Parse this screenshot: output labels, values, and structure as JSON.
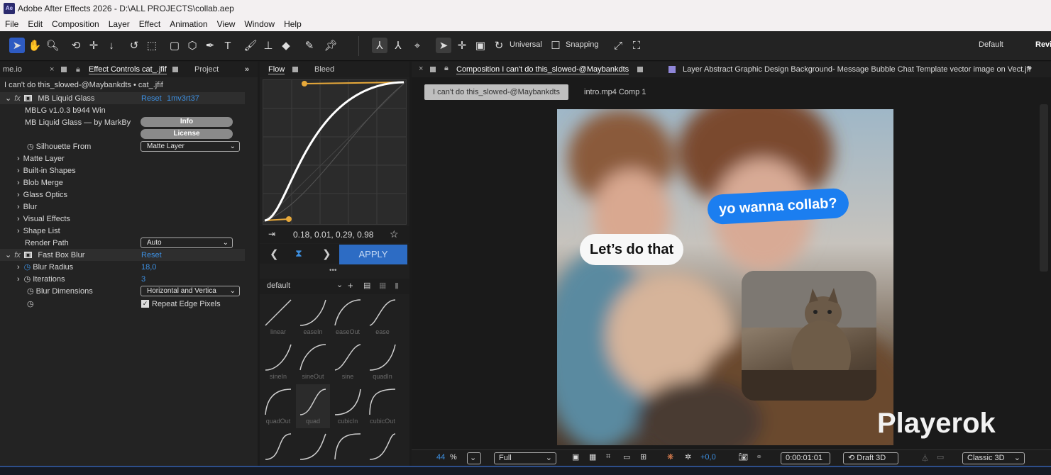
{
  "window": {
    "title": "Adobe After Effects 2026 - D:\\ALL PROJECTS\\collab.aep",
    "logo_text": "Ae"
  },
  "menu": [
    "File",
    "Edit",
    "Composition",
    "Layer",
    "Effect",
    "Animation",
    "View",
    "Window",
    "Help"
  ],
  "toolbar": {
    "universal_label": "Universal",
    "snapping_label": "Snapping",
    "workspace_default": "Default",
    "workspace_review": "Revi"
  },
  "left_panel": {
    "tab_partial": "me.io",
    "tab_effect_controls": "Effect Controls cat_.jfif",
    "tab_project": "Project",
    "header": "I can't do this_slowed-@Maybankdts • cat_.jfif",
    "effect1": {
      "name": "MB Liquid Glass",
      "reset": "Reset",
      "extra": "1mv3rt37"
    },
    "version": "MBLG v1.0.3 b944 Win",
    "byline": "MB Liquid Glass — by MarkBy",
    "info_btn": "Info",
    "license_btn": "License",
    "silhouette_label": "Silhouette From",
    "silhouette_value": "Matte Layer",
    "groups": [
      "Matte Layer",
      "Built-in Shapes",
      "Blob Merge",
      "Glass Optics",
      "Blur",
      "Visual Effects",
      "Shape List"
    ],
    "render_path_label": "Render Path",
    "render_path_value": "Auto",
    "effect2": {
      "name": "Fast Box Blur",
      "reset": "Reset"
    },
    "blur_radius_label": "Blur Radius",
    "blur_radius_value": "18,0",
    "iterations_label": "Iterations",
    "iterations_value": "3",
    "blur_dims_label": "Blur Dimensions",
    "blur_dims_value": "Horizontal and Vertica",
    "repeat_edge_label": "Repeat Edge Pixels"
  },
  "flow_panel": {
    "tab_flow": "Flow",
    "tab_bleed": "Bleed",
    "values": "0.18, 0.01, 0.29, 0.98",
    "apply": "APPLY",
    "preset_set": "default",
    "presets": [
      "linear",
      "easeIn",
      "easeOut",
      "ease",
      "sineIn",
      "sineOut",
      "sine",
      "quadIn",
      "quadOut",
      "quad",
      "cubicIn",
      "cubicOut",
      "",
      "",
      "",
      ""
    ],
    "accent": "#e8a93a"
  },
  "composition": {
    "tab_label": "Composition I can't do this_slowed-@Maybankdts",
    "layer_tab": "Layer Abstract Graphic Design Background- Message Bubble Chat Template vector image on Vect.jfi",
    "subtab_active": "I can't do this_slowed-@Maybankdts",
    "subtab_other": "intro.mp4 Comp 1",
    "bubble_left": "Let’s do that",
    "bubble_right": "yo wanna collab?",
    "watermark": "Playerok"
  },
  "footer": {
    "zoom": "44",
    "zoom_unit": "%",
    "resolution": "Full",
    "exposure": "+0,0",
    "timecode": "0:00:01:01",
    "draft": "Draft 3D",
    "renderer": "Classic 3D"
  }
}
